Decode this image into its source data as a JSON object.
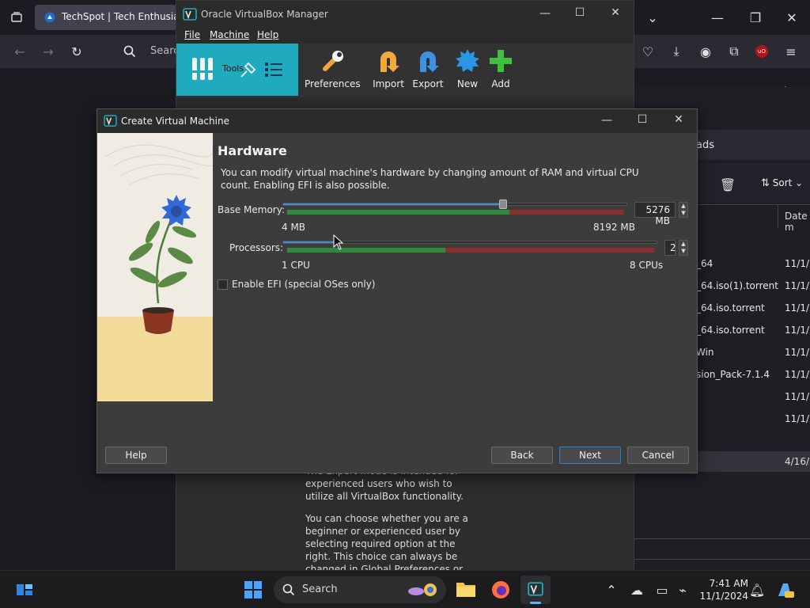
{
  "browser": {
    "tab_title": "TechSpot | Tech Enthusiasts",
    "search_placeholder": "Search",
    "downloads_heading_fragment": "ads",
    "sort_label": "Sort",
    "date_col": "Date m",
    "rows": [
      {
        "name": "_64",
        "date": "11/1/2"
      },
      {
        "name": "_64.iso(1).torrent",
        "date": "11/1/2"
      },
      {
        "name": "_64.iso.torrent",
        "date": "11/1/2"
      },
      {
        "name": "_64.iso.torrent",
        "date": "11/1/2"
      },
      {
        "name": "Win",
        "date": "11/1/2"
      },
      {
        "name": "sion_Pack-7.1.4",
        "date": "11/1/2"
      },
      {
        "name": "",
        "date": "11/1/2"
      },
      {
        "name": "",
        "date": "11/1/2"
      }
    ],
    "bottom_row_date": "4/16/2"
  },
  "vbox": {
    "title": "Oracle VirtualBox Manager",
    "menu": [
      "File",
      "Machine",
      "Help"
    ],
    "tools_label": "Tools",
    "toolbar": [
      "Preferences",
      "Import",
      "Export",
      "New",
      "Add"
    ],
    "side_text_1": "The Expert mode is intended for experienced users who wish to utilize all VirtualBox functionality.",
    "side_text_2": "You can choose whether you are a beginner or experienced user by selecting required option at the right. This choice can always be changed in Global Preferences or Machine"
  },
  "dialog": {
    "title": "Create Virtual Machine",
    "heading": "Hardware",
    "description": "You can modify virtual machine's hardware by changing amount of RAM and virtual CPU count. Enabling EFI is also possible.",
    "memory": {
      "label": "Base Memory:",
      "value": "5276 MB",
      "min": "4 MB",
      "max": "8192 MB",
      "fraction": 0.644
    },
    "processors": {
      "label": "Processors:",
      "value": "2",
      "min": "1 CPU",
      "max": "8 CPUs",
      "fraction": 0.143
    },
    "efi_label": "Enable EFI (special OSes only)",
    "buttons": {
      "help": "Help",
      "back": "Back",
      "next": "Next",
      "cancel": "Cancel"
    }
  },
  "taskbar": {
    "search": "Search",
    "time": "7:41 AM",
    "date": "11/1/2024"
  },
  "colors": {
    "accent": "#1faabe",
    "green": "#2f8a3a",
    "red": "#8c2e2e"
  }
}
